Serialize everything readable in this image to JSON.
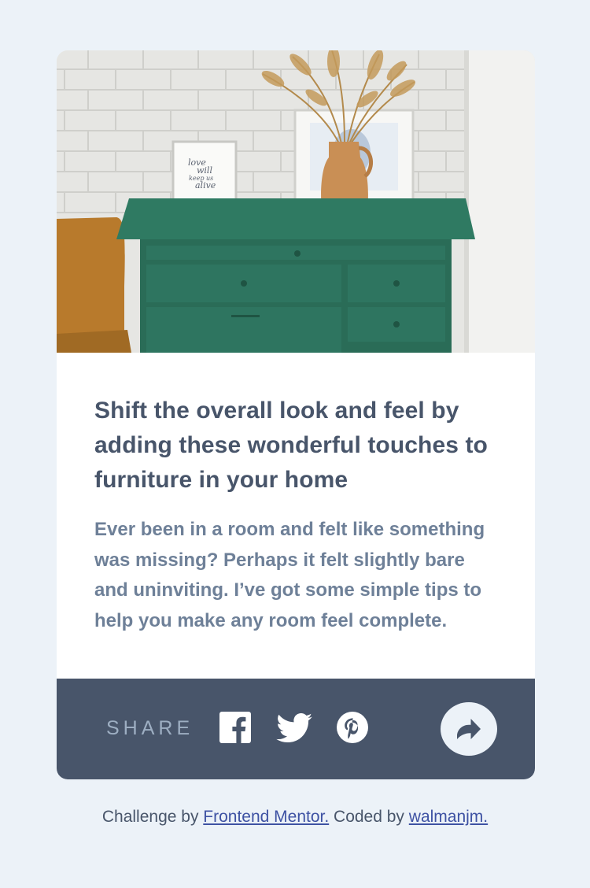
{
  "article": {
    "image_alt": "Green drawer cabinet with vase and framed prints",
    "photo_text": [
      "love",
      "will",
      "keep us",
      "alive"
    ],
    "title": "Shift the overall look and feel by adding these wonderful touches to furniture in your home",
    "description": "Ever been in a room and felt like something was missing? Perhaps it felt slightly bare and uninviting. I’ve got some simple tips to help you make any room feel complete."
  },
  "share_bar": {
    "label": "SHARE",
    "icons": [
      "facebook-icon",
      "twitter-icon",
      "pinterest-icon",
      "share-icon"
    ]
  },
  "footer": {
    "prefix": "Challenge by ",
    "link1": "Frontend Mentor.",
    "middle": " Coded by ",
    "link2": "walmanjm."
  },
  "colors": {
    "background": "#ECF2F8",
    "card": "#FFFFFF",
    "title": "#48556A",
    "text": "#6E8098",
    "share_bar": "#48556A",
    "share_label": "#9DAEC2",
    "link": "#3E52A3"
  }
}
